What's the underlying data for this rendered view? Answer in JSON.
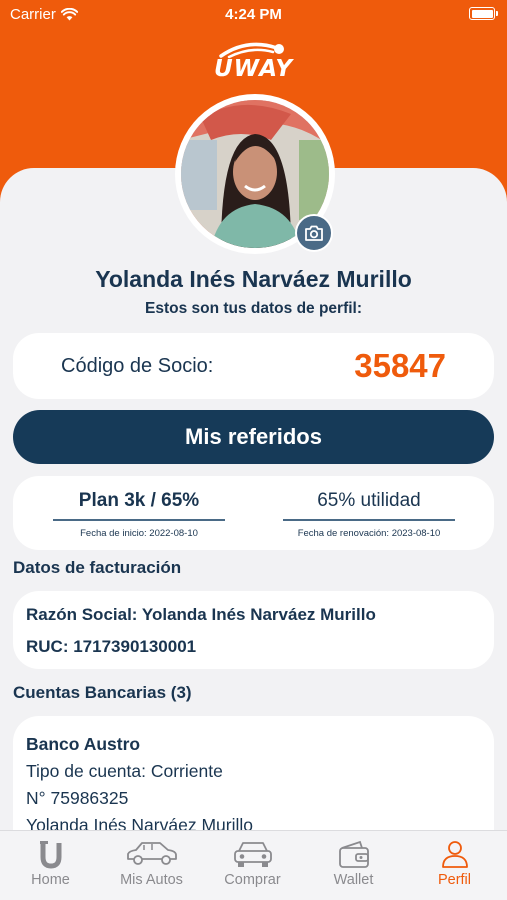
{
  "status_bar": {
    "carrier": "Carrier",
    "time": "4:24 PM"
  },
  "brand": {
    "name": "UWAY",
    "accent": "#ef5b0c",
    "navy": "#163a58"
  },
  "profile": {
    "name": "Yolanda Inés Narváez Murillo",
    "subtitle": "Estos son tus datos de perfil:"
  },
  "socio": {
    "label": "Código de Socio:",
    "code": "35847"
  },
  "referidos_button": "Mis referidos",
  "plan": {
    "name": "Plan 3k / 65%",
    "start_label": "Fecha de inicio: 2022-08-10",
    "utility": "65% utilidad",
    "renewal_label": "Fecha de renovación: 2023-08-10"
  },
  "billing": {
    "title": "Datos de facturación",
    "razon_social": "Razón Social: Yolanda Inés Narváez Murillo",
    "ruc": "RUC: 1717390130001"
  },
  "bank_accounts": {
    "title": "Cuentas Bancarias (3)",
    "items": [
      {
        "bank": "Banco Austro",
        "type": "Tipo de cuenta: Corriente",
        "number": "N° 75986325",
        "holder": "Yolanda Inés Narváez Murillo"
      }
    ]
  },
  "tabs": [
    {
      "label": "Home",
      "icon": "u-logo-icon",
      "active": false
    },
    {
      "label": "Mis Autos",
      "icon": "car-icon",
      "active": false
    },
    {
      "label": "Comprar",
      "icon": "car-front-icon",
      "active": false
    },
    {
      "label": "Wallet",
      "icon": "wallet-icon",
      "active": false
    },
    {
      "label": "Perfil",
      "icon": "person-icon",
      "active": true
    }
  ]
}
